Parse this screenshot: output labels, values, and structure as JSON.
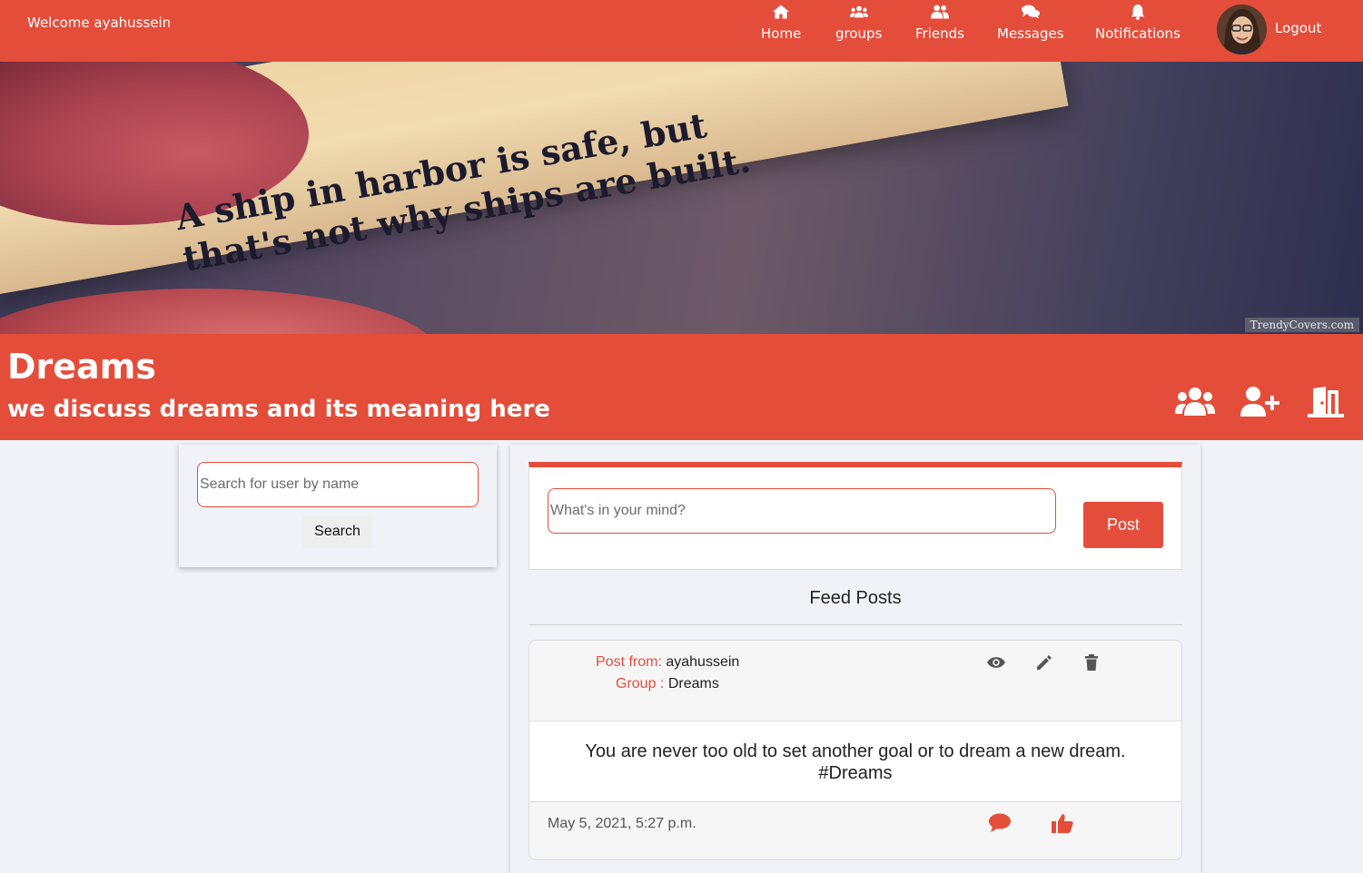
{
  "navbar": {
    "welcome": "Welcome ayahussein",
    "items": [
      {
        "label": "Home",
        "icon": "home-icon"
      },
      {
        "label": "groups",
        "icon": "groups-icon"
      },
      {
        "label": "Friends",
        "icon": "friends-icon"
      },
      {
        "label": "Messages",
        "icon": "messages-icon"
      },
      {
        "label": "Notifications",
        "icon": "bell-icon"
      }
    ],
    "logout": "Logout"
  },
  "banner": {
    "quote_line1": "A ship in harbor is safe, but",
    "quote_line2": "that's not why ships are built.",
    "watermark": "TrendyCovers.com"
  },
  "group": {
    "title": "Dreams",
    "description": "we discuss dreams and its meaning here",
    "actions": [
      "members-icon",
      "add-user-icon",
      "leave-door-icon"
    ]
  },
  "search": {
    "placeholder": "Search for user by name",
    "button": "Search"
  },
  "composer": {
    "placeholder": "What's in your mind?",
    "button": "Post"
  },
  "feed": {
    "title": "Feed Posts",
    "posts": [
      {
        "from_label": "Post from:",
        "from": "ayahussein",
        "group_label": "Group :",
        "group": "Dreams",
        "content_line1": "You are never too old to set another goal or to dream a new dream.",
        "content_line2": "#Dreams",
        "date": "May 5, 2021, 5:27 p.m."
      }
    ]
  },
  "colors": {
    "accent": "#e44d3a",
    "background": "#f0f2f8"
  }
}
